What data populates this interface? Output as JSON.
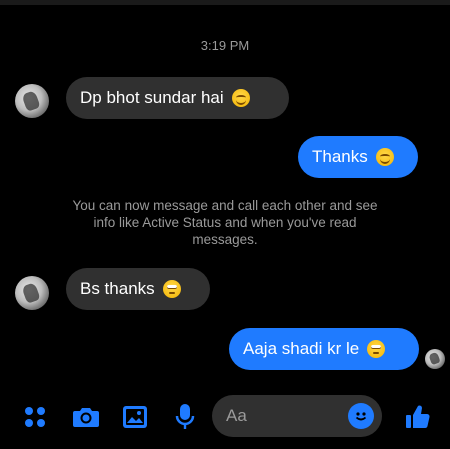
{
  "conversation": {
    "timestamp": "3:19 PM",
    "messages": [
      {
        "direction": "in",
        "text": "Dp bhot sundar hai",
        "emoji": "smiling-face-icon"
      },
      {
        "direction": "out",
        "text": "Thanks",
        "emoji": "smiling-face-icon"
      },
      {
        "direction": "in",
        "text": "Bs thanks",
        "emoji": "eye-roll-face-icon"
      },
      {
        "direction": "out",
        "text": "Aaja shadi kr le",
        "emoji": "eye-roll-face-icon"
      }
    ],
    "info_text": "You can now message and call each other and see info like Active Status and when you've read messages."
  },
  "composer": {
    "placeholder": "Aa",
    "icons": [
      "apps-icon",
      "camera-icon",
      "gallery-icon",
      "microphone-icon",
      "emoji-icon",
      "thumbs-up-icon"
    ]
  },
  "colors": {
    "background": "#000000",
    "incoming_bubble": "#303030",
    "outgoing_bubble": "#1f7bff",
    "accent": "#1f7bff",
    "muted_text": "#9a9a9a"
  }
}
